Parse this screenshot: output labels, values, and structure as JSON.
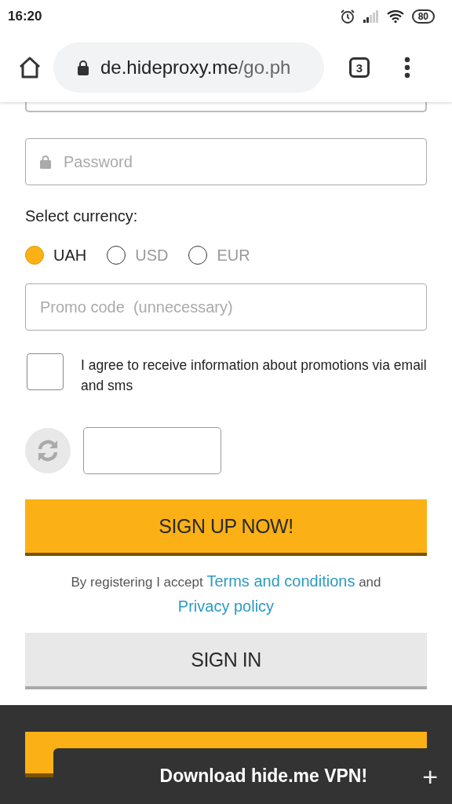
{
  "status_bar": {
    "time": "16:20",
    "battery": "80"
  },
  "browser": {
    "url_host": "de.hideproxy.me",
    "url_path": "/go.ph",
    "tab_count": "3"
  },
  "form": {
    "password": {
      "placeholder": "Password"
    },
    "currency_label": "Select currency:",
    "currencies": [
      {
        "label": "UAH",
        "selected": true
      },
      {
        "label": "USD",
        "selected": false
      },
      {
        "label": "EUR",
        "selected": false
      }
    ],
    "promo": {
      "placeholder": "Promo code  (unnecessary)"
    },
    "agree": {
      "text": "I agree to receive information about promotions via email and sms",
      "checked": false
    },
    "sign_up": "SIGN UP NOW!",
    "terms": {
      "prefix": "By registering I accept",
      "terms_link": "Terms and conditions",
      "joiner": "and",
      "privacy_link": "Privacy policy"
    },
    "sign_in": "SIGN IN"
  },
  "banner": {
    "text": "Download hide.me VPN!",
    "close": "+"
  }
}
